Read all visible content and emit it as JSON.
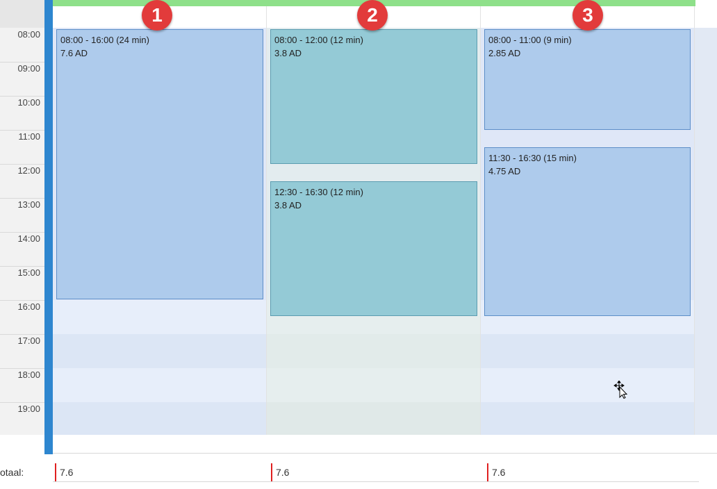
{
  "time_labels": [
    "08:00",
    "09:00",
    "10:00",
    "11:00",
    "12:00",
    "13:00",
    "14:00",
    "15:00",
    "16:00",
    "17:00",
    "18:00",
    "19:00"
  ],
  "columns": [
    {
      "badge": "1"
    },
    {
      "badge": "2"
    },
    {
      "badge": "3"
    }
  ],
  "events": {
    "c1e1": {
      "time": "08:00 - 16:00 (24 min)",
      "value": "7.6 AD"
    },
    "c2e1": {
      "time": "08:00 - 12:00 (12 min)",
      "value": "3.8 AD"
    },
    "c2e2": {
      "time": "12:30 - 16:30 (12 min)",
      "value": "3.8 AD"
    },
    "c3e1": {
      "time": "08:00 - 11:00 (9 min)",
      "value": "2.85 AD"
    },
    "c3e2": {
      "time": "11:30 - 16:30 (15 min)",
      "value": "4.75 AD"
    }
  },
  "totals": {
    "label": "otaal:",
    "values": [
      "7.6",
      "7.6",
      "7.6"
    ]
  },
  "colors": {
    "accent": "#2e86cf",
    "event_blue": "#aecbec",
    "event_teal": "#94cad6",
    "badge": "#e23b3b",
    "header_strip": "#8ee08a"
  }
}
